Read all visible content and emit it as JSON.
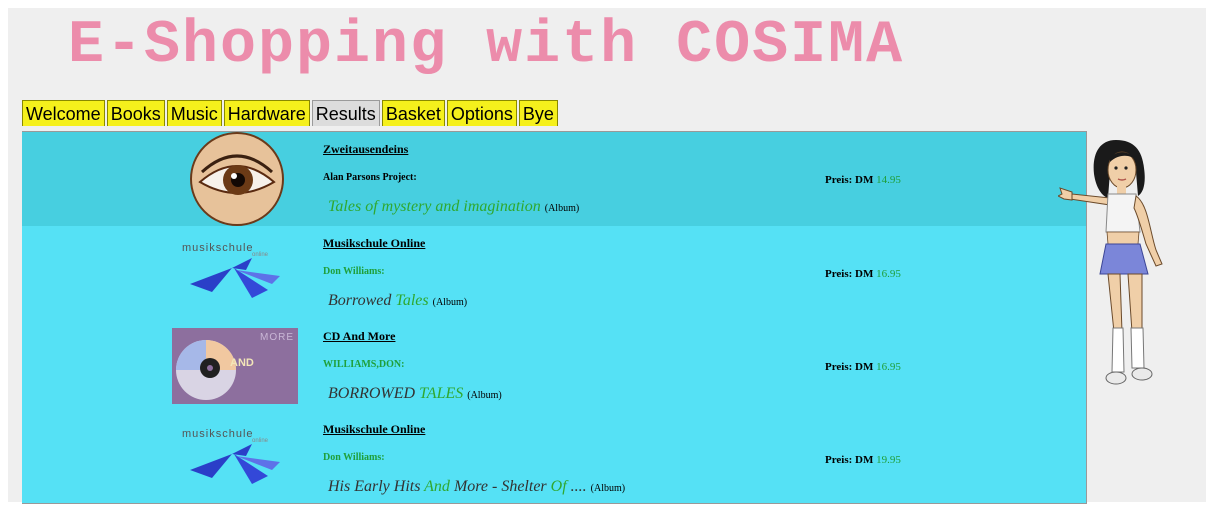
{
  "page_title": "E-Shopping with COSIMA",
  "tabs": [
    {
      "label": "Welcome",
      "active": false
    },
    {
      "label": "Books",
      "active": false
    },
    {
      "label": "Music",
      "active": false
    },
    {
      "label": "Hardware",
      "active": false
    },
    {
      "label": "Results",
      "active": true
    },
    {
      "label": "Basket",
      "active": false
    },
    {
      "label": "Options",
      "active": false
    },
    {
      "label": "Bye",
      "active": false
    }
  ],
  "results": [
    {
      "shop": "Zweitausendeins",
      "artist": "Alan Parsons Project:",
      "album_parts": [
        {
          "t": "Tales of mystery and imagination",
          "hl": true
        }
      ],
      "album_kind": "(Album)",
      "price_label": "Preis: DM",
      "price_value": "14.95",
      "logo": "eye-logo",
      "highlighted": true
    },
    {
      "shop": "Musikschule Online",
      "artist": "Don Williams:",
      "album_parts": [
        {
          "t": "Borrowed ",
          "hl": false
        },
        {
          "t": "Tales",
          "hl": true
        }
      ],
      "album_kind": "(Album)",
      "price_label": "Preis: DM",
      "price_value": "16.95",
      "logo": "musikschule-logo",
      "logo_text": "musikschule",
      "logo_subtext": "online",
      "highlighted": false
    },
    {
      "shop": "CD And More",
      "artist": "WILLIAMS,DON:",
      "album_parts": [
        {
          "t": "BORROWED ",
          "hl": false
        },
        {
          "t": "TALES",
          "hl": true
        }
      ],
      "album_kind": "(Album)",
      "price_label": "Preis: DM",
      "price_value": "16.95",
      "logo": "cd-and-more-logo",
      "logo_text": "AND",
      "logo_subtext": "MORE",
      "highlighted": false
    },
    {
      "shop": "Musikschule Online",
      "artist": "Don Williams:",
      "album_parts": [
        {
          "t": "His Early Hits ",
          "hl": false
        },
        {
          "t": "And",
          "hl": true
        },
        {
          "t": " More - Shelter ",
          "hl": false
        },
        {
          "t": "Of",
          "hl": true
        },
        {
          "t": " ....",
          "hl": false
        }
      ],
      "album_kind": "(Album)",
      "price_label": "Preis: DM",
      "price_value": "19.95",
      "logo": "musikschule-logo",
      "logo_text": "musikschule",
      "logo_subtext": "online",
      "highlighted": false
    }
  ],
  "colors": {
    "title": "#ec8cab",
    "tab": "#f5f01c",
    "tab_active": "#dcdcdc",
    "results_bg": "#55e1f5",
    "row_highlight": "#47cfe0",
    "price_value": "#1f9f3a",
    "highlight_text": "#2fa82f"
  },
  "assistant": {
    "icon": "cosima-assistant-figure"
  }
}
